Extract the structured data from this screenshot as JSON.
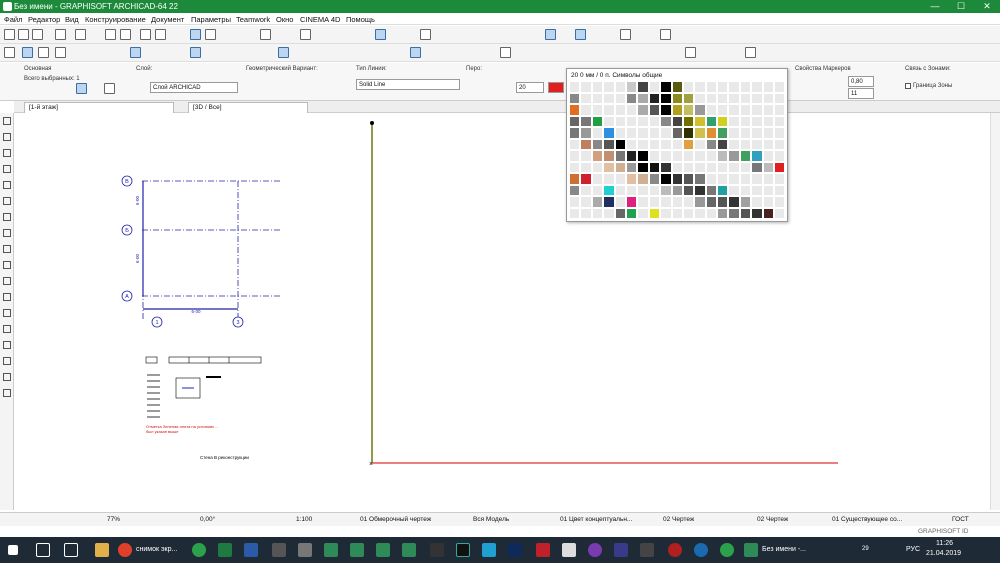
{
  "window": {
    "title": "Без имени - GRAPHISOFT ARCHICAD-64 22",
    "minimize": "—",
    "maximize": "☐",
    "close": "✕"
  },
  "menu": [
    "Файл",
    "Редактор",
    "Вид",
    "Конструирование",
    "Документ",
    "Параметры",
    "Teamwork",
    "Окно",
    "CINEMA 4D",
    "Помощь"
  ],
  "infobox": {
    "main_label": "Основная",
    "selected": "Всего выбранных: 1",
    "layer_label": "Слой:",
    "layer_value": "Слой ARCHICAD",
    "geom_label": "Геометрический Вариант:",
    "linetype_label": "Тип Линии:",
    "linetype_value": "Solid Line",
    "pen_label": "Перо:",
    "pen_value": "20",
    "marker_label": "Свойства Маркеров",
    "marker_v1": "0,80",
    "marker_v2": "11",
    "zone_label": "Связь с Зонами:",
    "zone_value": "Граница Зоны"
  },
  "tabs": {
    "floor": "[1-й этаж]",
    "view3d": "[3D / Все]"
  },
  "palette": {
    "header": "20 0 мм / 0 п. Символы общие",
    "colors": [
      "#e9e9e9",
      "#e9e9e9",
      "#e9e9e9",
      "#e9e9e9",
      "#e9e9e9",
      "#c8c8c8",
      "#444",
      "#e9e9e9",
      "#000",
      "#5a5a10",
      "#e9e9e9",
      "#e9e9e9",
      "#e9e9e9",
      "#e9e9e9",
      "#e9e9e9",
      "#e9e9e9",
      "#e9e9e9",
      "#e9e9e9",
      "#e9e9e9",
      "#888",
      "#e9e9e9",
      "#e9e9e9",
      "#e9e9e9",
      "#e9e9e9",
      "#888",
      "#aaa",
      "#222",
      "#000",
      "#8a8a20",
      "#a0a040",
      "#e9e9e9",
      "#e9e9e9",
      "#e9e9e9",
      "#e9e9e9",
      "#e9e9e9",
      "#e9e9e9",
      "#e9e9e9",
      "#e9e9e9",
      "#e07020",
      "#e9e9e9",
      "#e9e9e9",
      "#e9e9e9",
      "#e9e9e9",
      "#e9e9e9",
      "#aaa",
      "#555",
      "#000",
      "#b0a020",
      "#c0c060",
      "#999",
      "#e9e9e9",
      "#e9e9e9",
      "#e9e9e9",
      "#e9e9e9",
      "#e9e9e9",
      "#e9e9e9",
      "#e9e9e9",
      "#666",
      "#777",
      "#20a040",
      "#e9e9e9",
      "#e9e9e9",
      "#e9e9e9",
      "#e9e9e9",
      "#e9e9e9",
      "#888",
      "#444",
      "#707000",
      "#d0c030",
      "#30a070",
      "#d0d020",
      "#e9e9e9",
      "#e9e9e9",
      "#e9e9e9",
      "#e9e9e9",
      "#e9e9e9",
      "#777",
      "#999",
      "#e9e9e9",
      "#3090e0",
      "#e9e9e9",
      "#e9e9e9",
      "#e9e9e9",
      "#e9e9e9",
      "#e9e9e9",
      "#666",
      "#303000",
      "#d0c050",
      "#e09030",
      "#40a060",
      "#e9e9e9",
      "#e9e9e9",
      "#e9e9e9",
      "#e9e9e9",
      "#e9e9e9",
      "#e9e9e9",
      "#c08060",
      "#888",
      "#555",
      "#000",
      "#e9e9e9",
      "#e9e9e9",
      "#e9e9e9",
      "#e9e9e9",
      "#e9e9e9",
      "#e0a040",
      "#e9e9e9",
      "#888",
      "#444",
      "#e9e9e9",
      "#e9e9e9",
      "#e9e9e9",
      "#e9e9e9",
      "#e9e9e9",
      "#e9e9e9",
      "#e9e9e9",
      "#d0a080",
      "#c09070",
      "#777",
      "#222",
      "#000",
      "#e9e9e9",
      "#e9e9e9",
      "#e9e9e9",
      "#e9e9e9",
      "#e9e9e9",
      "#e9e9e9",
      "#bbb",
      "#999",
      "#40a060",
      "#30a0c0",
      "#e9e9e9",
      "#e9e9e9",
      "#e9e9e9",
      "#e9e9e9",
      "#e9e9e9",
      "#e0c0a0",
      "#d0b090",
      "#999",
      "#000",
      "#111",
      "#333",
      "#e9e9e9",
      "#e9e9e9",
      "#e9e9e9",
      "#e9e9e9",
      "#e9e9e9",
      "#e9e9e9",
      "#e9e9e9",
      "#777",
      "#bbb",
      "#e02020",
      "#d07030",
      "#d02030",
      "#e9e9e9",
      "#e9e9e9",
      "#e9e9e9",
      "#e0c0a0",
      "#d0b090",
      "#888",
      "#000",
      "#333",
      "#555",
      "#777",
      "#e9e9e9",
      "#e9e9e9",
      "#e9e9e9",
      "#e9e9e9",
      "#e9e9e9",
      "#e9e9e9",
      "#e9e9e9",
      "#888",
      "#e9e9e9",
      "#e9e9e9",
      "#20d0d0",
      "#e9e9e9",
      "#e9e9e9",
      "#e9e9e9",
      "#e9e9e9",
      "#bbb",
      "#999",
      "#555",
      "#333",
      "#777",
      "#20a0a0",
      "#e9e9e9",
      "#e9e9e9",
      "#e9e9e9",
      "#e9e9e9",
      "#e9e9e9",
      "#e9e9e9",
      "#e9e9e9",
      "#aaa",
      "#203060",
      "#e9e9e9",
      "#e02080",
      "#e9e9e9",
      "#e9e9e9",
      "#e9e9e9",
      "#e9e9e9",
      "#e9e9e9",
      "#999",
      "#666",
      "#555",
      "#333",
      "#a0a0a0",
      "#e9e9e9",
      "#e9e9e9",
      "#e9e9e9",
      "#e9e9e9",
      "#e9e9e9",
      "#e9e9e9",
      "#e9e9e9",
      "#666",
      "#20a050",
      "#e9e9e9",
      "#e0e020",
      "#e9e9e9",
      "#e9e9e9",
      "#e9e9e9",
      "#e9e9e9",
      "#e9e9e9",
      "#999",
      "#777",
      "#555",
      "#333",
      "#4a2020",
      "#e9e9e9",
      "#e9e9e9",
      "#e9e9e9",
      "#e9e9e9",
      "#e9e9e9",
      "#e9e9e9",
      "#e9e9e9",
      "#e9e9e9",
      "#e9e9e9",
      "#e9e9e9",
      "#e9e9e9"
    ]
  },
  "plan": {
    "axis_b": "В",
    "axis_a1": "Б",
    "axis_a": "А",
    "axis_1": "1",
    "axis_3": "3",
    "dim_v1": "6·00",
    "dim_v2": "6·00",
    "dim_h": "6·00",
    "text_red1": "Отметка Зеленая плита на условиях ...",
    "text_red2": "был указан выше",
    "text_note": "Стена В реконструкции"
  },
  "status": {
    "zoom": "77%",
    "angle": "0,00°",
    "scale": "1:100",
    "layer_combo": "01 Обмерочный чертеж",
    "model": "Вся Модель",
    "pen_set": "01 Цвет концептуальн...",
    "drawing1": "02 Чертеж",
    "drawing2": "02 Чертеж",
    "existing": "01 Существующее со...",
    "standard": "ГОСТ",
    "brand": "GRAPHISOFT ID"
  },
  "taskbar": {
    "chrome_task": "снимок экр...",
    "archicad_task": "Без имени -...",
    "lang": "РУС",
    "time": "11:26",
    "date": "21.04.2019",
    "temp": "29"
  }
}
